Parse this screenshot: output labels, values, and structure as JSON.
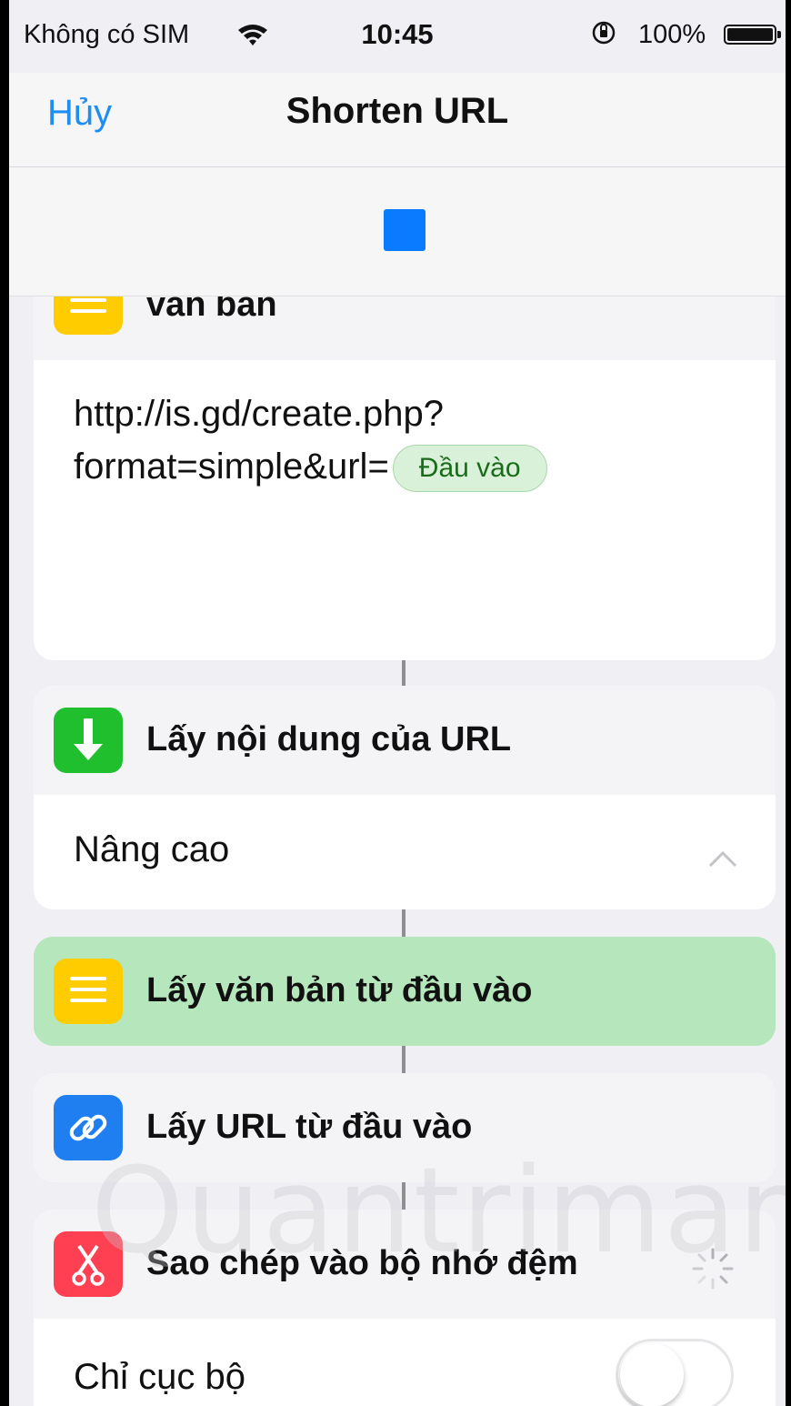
{
  "status_bar": {
    "carrier": "Không có SIM",
    "time": "10:45",
    "battery_percent": "100%"
  },
  "nav": {
    "cancel_label": "Hủy",
    "title": "Shorten URL"
  },
  "actions": [
    {
      "title": "văn bản",
      "icon": "text-lines-icon",
      "color": "#ffcc00",
      "content_line1": "http://is.gd/create.php?",
      "content_line2": "format=simple&url=",
      "variable_token": "Đầu vào"
    },
    {
      "title": "Lấy nội dung của URL",
      "icon": "download-arrow-icon",
      "color": "#1fbf2e",
      "advanced_label": "Nâng cao"
    },
    {
      "title": "Lấy văn bản từ đầu vào",
      "icon": "text-lines-icon",
      "color": "#ffcc00",
      "highlighted": true
    },
    {
      "title": "Lấy URL từ đầu vào",
      "icon": "link-icon",
      "color": "#1f7ff0"
    },
    {
      "title": "Sao chép vào bộ nhớ đệm",
      "icon": "scissors-icon",
      "color": "#ff4052",
      "option_label": "Chỉ cục bộ",
      "option_enabled": false
    }
  ],
  "watermark": "Quantrimang"
}
